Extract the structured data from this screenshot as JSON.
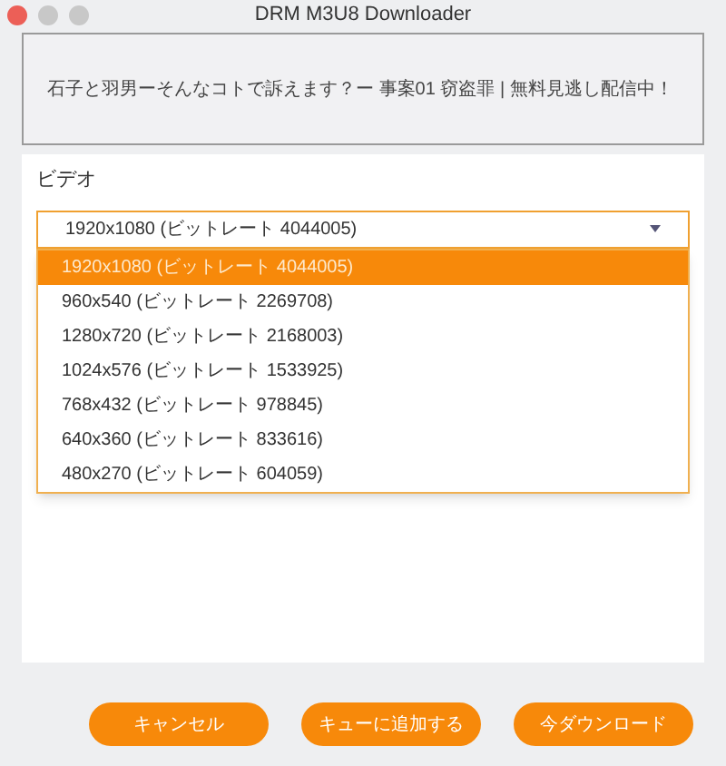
{
  "window": {
    "title": "DRM M3U8 Downloader"
  },
  "video_title": "石子と羽男ーそんなコトで訴えます？ー 事案01 窃盗罪 | 無料見逃し配信中！",
  "video": {
    "label": "ビデオ",
    "value": "1920x1080 (ビットレート 4044005)",
    "expanded": true,
    "options": [
      {
        "label": "1920x1080 (ビットレート 4044005)",
        "selected": true
      },
      {
        "label": "960x540 (ビットレート 2269708)",
        "selected": false
      },
      {
        "label": "1280x720 (ビットレート 2168003)",
        "selected": false
      },
      {
        "label": "1024x576 (ビットレート 1533925)",
        "selected": false
      },
      {
        "label": "768x432 (ビットレート 978845)",
        "selected": false
      },
      {
        "label": "640x360 (ビットレート 833616)",
        "selected": false
      },
      {
        "label": "480x270 (ビットレート 604059)",
        "selected": false
      }
    ]
  },
  "buttons": [
    "キャンセル",
    "キューに追加する",
    "今ダウンロード"
  ]
}
